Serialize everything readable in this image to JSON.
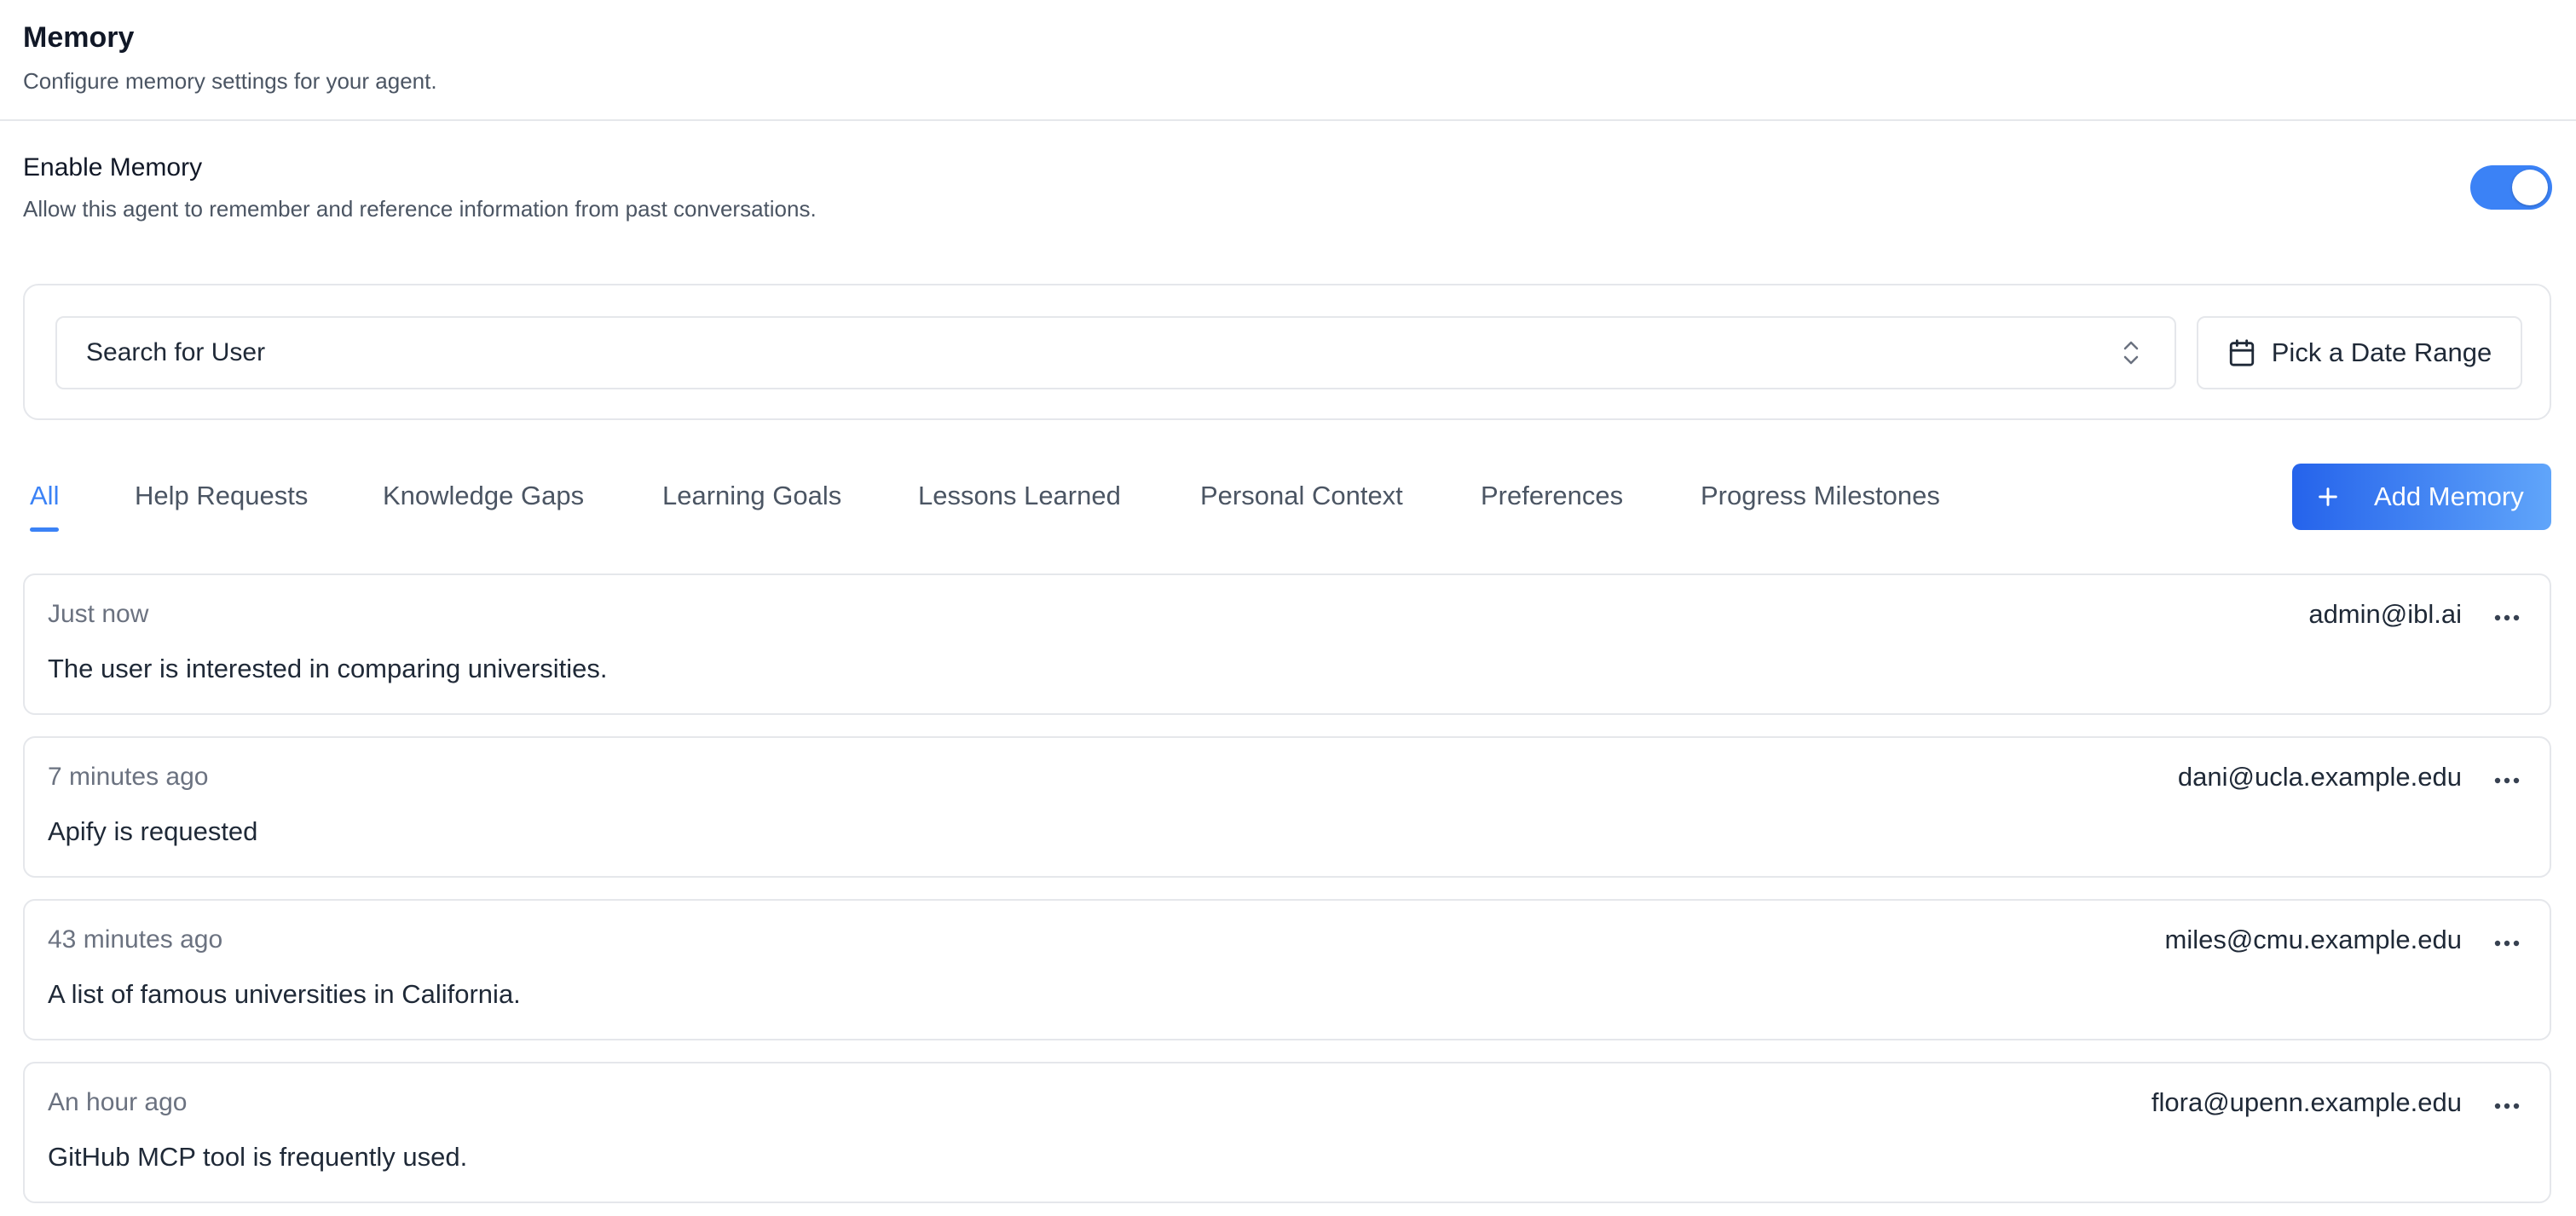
{
  "header": {
    "title": "Memory",
    "subtitle": "Configure memory settings for your agent."
  },
  "enable_memory": {
    "title": "Enable Memory",
    "description": "Allow this agent to remember and reference information from past conversations.",
    "enabled": true
  },
  "filters": {
    "user_select_placeholder": "Search for User",
    "date_range_label": "Pick a Date Range"
  },
  "tabs": [
    {
      "label": "All",
      "active": true
    },
    {
      "label": "Help Requests",
      "active": false
    },
    {
      "label": "Knowledge Gaps",
      "active": false
    },
    {
      "label": "Learning Goals",
      "active": false
    },
    {
      "label": "Lessons Learned",
      "active": false
    },
    {
      "label": "Personal Context",
      "active": false
    },
    {
      "label": "Preferences",
      "active": false
    },
    {
      "label": "Progress Milestones",
      "active": false
    }
  ],
  "add_memory_label": "Add Memory",
  "memories": [
    {
      "time": "Just now",
      "user": "admin@ibl.ai",
      "text": "The user is interested in comparing universities."
    },
    {
      "time": "7 minutes ago",
      "user": "dani@ucla.example.edu",
      "text": "Apify is requested"
    },
    {
      "time": "43 minutes ago",
      "user": "miles@cmu.example.edu",
      "text": "A list of famous universities in California."
    },
    {
      "time": "An hour ago",
      "user": "flora@upenn.example.edu",
      "text": "GitHub MCP tool is frequently used."
    }
  ],
  "colors": {
    "accent": "#3b82f6",
    "border": "#e5e7eb",
    "muted_text": "#6b7280"
  }
}
